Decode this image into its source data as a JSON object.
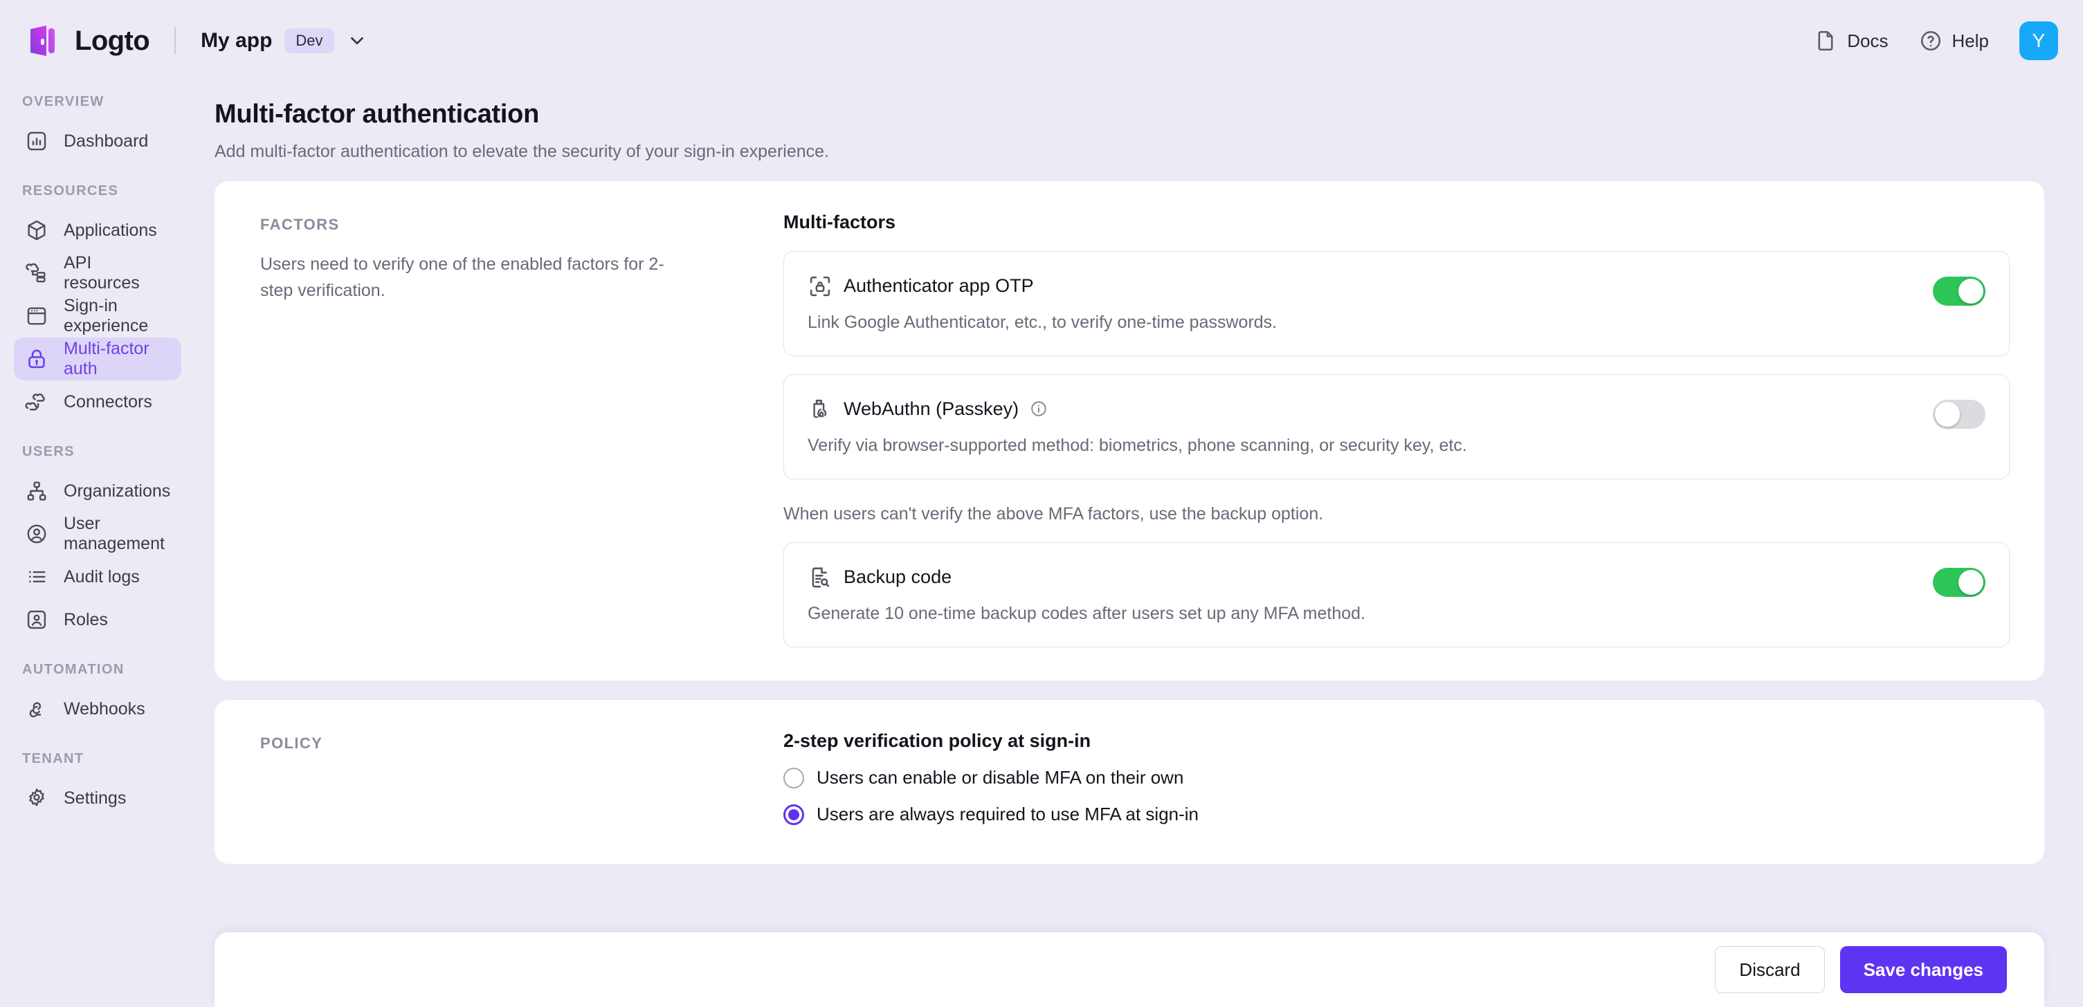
{
  "topbar": {
    "logo_icon": "logto-logo-icon",
    "brand_name": "Logto",
    "app_name": "My app",
    "env_badge": "Dev",
    "chevron_icon": "chevron-down-icon",
    "docs_label": "Docs",
    "docs_icon": "document-icon",
    "help_label": "Help",
    "help_icon": "question-circle-icon",
    "avatar_initial": "Y",
    "avatar_color": "#17a9f7"
  },
  "sidebar": {
    "groups": [
      {
        "label": "OVERVIEW",
        "items": [
          {
            "label": "Dashboard",
            "icon": "bar-chart-icon",
            "active": false
          }
        ]
      },
      {
        "label": "RESOURCES",
        "items": [
          {
            "label": "Applications",
            "icon": "cube-icon",
            "active": false
          },
          {
            "label": "API resources",
            "icon": "api-cloud-icon",
            "active": false
          },
          {
            "label": "Sign-in experience",
            "icon": "browser-window-icon",
            "active": false
          },
          {
            "label": "Multi-factor auth",
            "icon": "lock-icon",
            "active": true
          },
          {
            "label": "Connectors",
            "icon": "connectors-cloud-icon",
            "active": false
          }
        ]
      },
      {
        "label": "USERS",
        "items": [
          {
            "label": "Organizations",
            "icon": "org-tree-icon",
            "active": false
          },
          {
            "label": "User management",
            "icon": "user-circle-icon",
            "active": false
          },
          {
            "label": "Audit logs",
            "icon": "list-icon",
            "active": false
          },
          {
            "label": "Roles",
            "icon": "user-square-icon",
            "active": false
          }
        ]
      },
      {
        "label": "AUTOMATION",
        "items": [
          {
            "label": "Webhooks",
            "icon": "webhook-icon",
            "active": false
          }
        ]
      },
      {
        "label": "TENANT",
        "items": [
          {
            "label": "Settings",
            "icon": "gear-icon",
            "active": false
          }
        ]
      }
    ],
    "active_color": "#6d42e8",
    "active_bg": "#ddd5f8"
  },
  "page": {
    "title": "Multi-factor authentication",
    "subtitle": "Add multi-factor authentication to elevate the security of your sign-in experience."
  },
  "factors_panel": {
    "label": "FACTORS",
    "description": "Users need to verify one of the enabled factors for 2-step verification.",
    "section_title": "Multi-factors",
    "backup_note": "When users can't verify the above MFA factors, use the backup option.",
    "cards": [
      {
        "title": "Authenticator app OTP",
        "description": "Link Google Authenticator, etc., to verify one-time passwords.",
        "icon": "authenticator-scan-lock-icon",
        "has_info": false,
        "enabled": true
      },
      {
        "title": "WebAuthn (Passkey)",
        "description": "Verify via browser-supported method: biometrics, phone scanning, or security key, etc.",
        "icon": "security-key-fingerprint-icon",
        "has_info": true,
        "info_icon": "info-circle-icon",
        "enabled": false
      },
      {
        "title": "Backup code",
        "description": "Generate 10 one-time backup codes after users set up any MFA method.",
        "icon": "document-search-icon",
        "has_info": false,
        "enabled": true
      }
    ],
    "toggle_on_color": "#2cc558",
    "toggle_off_color": "#dcdce0"
  },
  "policy_panel": {
    "label": "POLICY",
    "section_title": "2-step verification policy at sign-in",
    "options": [
      {
        "label": "Users can enable or disable MFA on their own",
        "selected": false
      },
      {
        "label": "Users are always required to use MFA at sign-in",
        "selected": true
      }
    ],
    "selected_color": "#5d34f2"
  },
  "footer": {
    "discard_label": "Discard",
    "save_label": "Save changes",
    "save_color": "#5d34f2"
  }
}
